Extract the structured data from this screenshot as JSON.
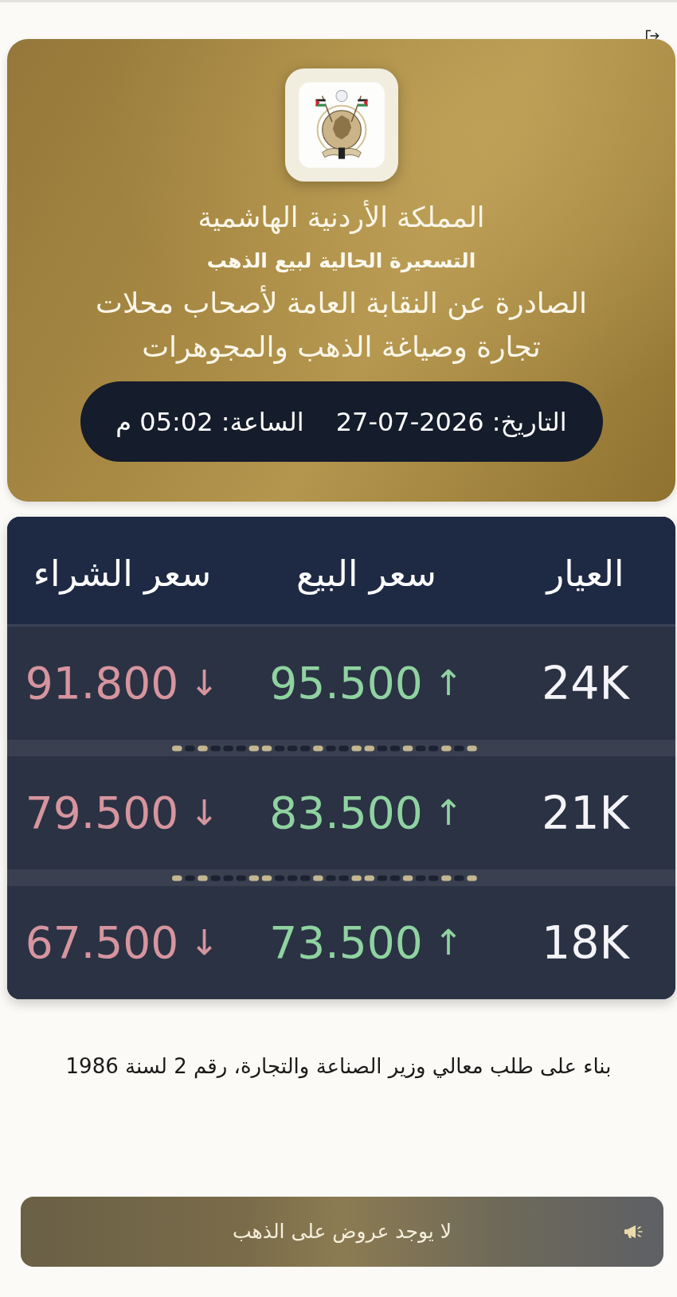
{
  "header": {
    "title": "المملكة الأردنية الهاشمية",
    "subtitle": "التسعيرة الحالية لبيع الذهب",
    "description": "الصادرة عن النقابة العامة لأصحاب محلات تجارة وصياغة الذهب والمجوهرات",
    "date": "التاريخ: 2026-07-27",
    "time": "الساعة: 05:02 م"
  },
  "table": {
    "columns": [
      "العيار",
      "سعر البيع",
      "سعر الشراء"
    ],
    "rows": [
      {
        "karat": "24K",
        "sell": {
          "value": "95.500",
          "arrow": "↑"
        },
        "buy": {
          "value": "91.800",
          "arrow": "↓"
        }
      },
      {
        "karat": "21K",
        "sell": {
          "value": "83.500",
          "arrow": "↑"
        },
        "buy": {
          "value": "79.500",
          "arrow": "↓"
        }
      },
      {
        "karat": "18K",
        "sell": {
          "value": "73.500",
          "arrow": "↑"
        },
        "buy": {
          "value": "67.500",
          "arrow": "↓"
        }
      }
    ]
  },
  "footnote": "بناء على طلب معالي وزير الصناعة والتجارة، رقم 2 لسنة 1986",
  "offers_banner": {
    "text": "لا يوجد عروض على الذهب"
  }
}
